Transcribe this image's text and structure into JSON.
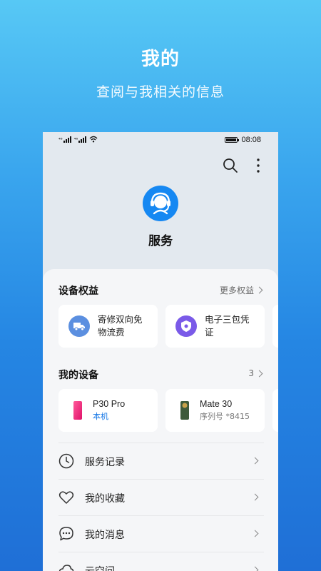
{
  "hero": {
    "title": "我的",
    "subtitle": "查阅与我相关的信息"
  },
  "statusbar": {
    "signal1": "⁴⁶",
    "signal2": "⁴⁶",
    "time": "08:08"
  },
  "service": {
    "label": "服务",
    "icon": "headset-icon"
  },
  "benefits": {
    "title": "设备权益",
    "more": "更多权益",
    "items": [
      {
        "line1": "寄修双向免",
        "line2": "物流费",
        "icon": "truck-icon",
        "color": "#5b8fe0"
      },
      {
        "line1": "电子三包凭",
        "line2": "证",
        "icon": "shield-icon",
        "color": "#7a5ae8"
      }
    ]
  },
  "devices": {
    "title": "我的设备",
    "count": "3",
    "items": [
      {
        "name": "P30 Pro",
        "sub": "本机",
        "icon": "phone-icon"
      },
      {
        "name": "Mate 30",
        "sub": "序列号 *8415",
        "icon": "phone-icon"
      }
    ]
  },
  "menu": [
    {
      "label": "服务记录",
      "icon": "clock-icon"
    },
    {
      "label": "我的收藏",
      "icon": "heart-icon"
    },
    {
      "label": "我的消息",
      "icon": "chat-icon"
    },
    {
      "label": "云空间",
      "icon": "cloud-icon"
    }
  ],
  "colors": {
    "accent": "#1688f2",
    "sheet": "#f5f6f8"
  }
}
